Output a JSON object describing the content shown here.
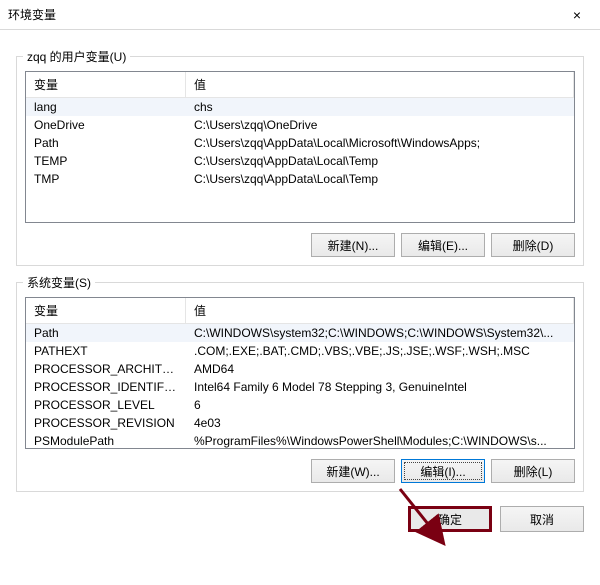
{
  "window": {
    "title": "环境变量",
    "close_glyph": "×"
  },
  "user_group": {
    "label": "zqq 的用户变量(U)",
    "header_name": "变量",
    "header_value": "值",
    "rows": [
      {
        "name": "lang",
        "value": "chs",
        "selected": true
      },
      {
        "name": "OneDrive",
        "value": "C:\\Users\\zqq\\OneDrive",
        "selected": false
      },
      {
        "name": "Path",
        "value": "C:\\Users\\zqq\\AppData\\Local\\Microsoft\\WindowsApps;",
        "selected": false
      },
      {
        "name": "TEMP",
        "value": "C:\\Users\\zqq\\AppData\\Local\\Temp",
        "selected": false
      },
      {
        "name": "TMP",
        "value": "C:\\Users\\zqq\\AppData\\Local\\Temp",
        "selected": false
      }
    ],
    "buttons": {
      "new": "新建(N)...",
      "edit": "编辑(E)...",
      "delete": "删除(D)"
    }
  },
  "sys_group": {
    "label": "系统变量(S)",
    "header_name": "变量",
    "header_value": "值",
    "rows": [
      {
        "name": "Path",
        "value": "C:\\WINDOWS\\system32;C:\\WINDOWS;C:\\WINDOWS\\System32\\...",
        "selected": true
      },
      {
        "name": "PATHEXT",
        "value": ".COM;.EXE;.BAT;.CMD;.VBS;.VBE;.JS;.JSE;.WSF;.WSH;.MSC",
        "selected": false
      },
      {
        "name": "PROCESSOR_ARCHITECTURE",
        "value": "AMD64",
        "selected": false
      },
      {
        "name": "PROCESSOR_IDENTIFIER",
        "value": "Intel64 Family 6 Model 78 Stepping 3, GenuineIntel",
        "selected": false
      },
      {
        "name": "PROCESSOR_LEVEL",
        "value": "6",
        "selected": false
      },
      {
        "name": "PROCESSOR_REVISION",
        "value": "4e03",
        "selected": false
      },
      {
        "name": "PSModulePath",
        "value": "%ProgramFiles%\\WindowsPowerShell\\Modules;C:\\WINDOWS\\s...",
        "selected": false
      }
    ],
    "buttons": {
      "new": "新建(W)...",
      "edit": "编辑(I)...",
      "delete": "删除(L)"
    }
  },
  "dialog_buttons": {
    "ok": "确定",
    "cancel": "取消"
  },
  "arrow_color": "#7a0012"
}
